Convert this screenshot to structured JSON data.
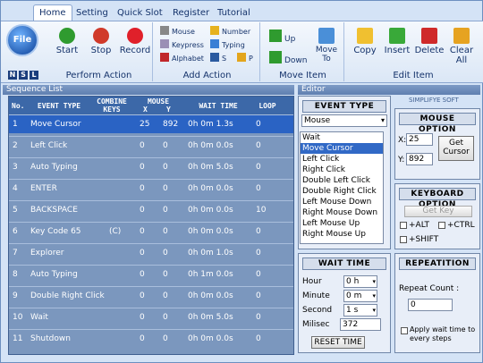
{
  "tabs": [
    "Home",
    "Setting",
    "Quick Slot",
    "Register",
    "Tutorial"
  ],
  "file_button": "File",
  "nsl": [
    "N",
    "S",
    "L"
  ],
  "groups": {
    "perform": {
      "label": "Perform Action",
      "buttons": [
        "Start",
        "Stop",
        "Record"
      ]
    },
    "add": {
      "label": "Add Action",
      "items": [
        "Mouse",
        "Keypress",
        "Alphabet",
        "Number",
        "Typing",
        "S",
        "P"
      ]
    },
    "move": {
      "label": "Move Item",
      "items": [
        "Up",
        "Down"
      ],
      "move_to": "Move To"
    },
    "edit": {
      "label": "Edit Item",
      "buttons": [
        "Copy",
        "Insert",
        "Delete",
        "Clear All"
      ]
    }
  },
  "panes": {
    "sequence_list": "Sequence List",
    "editor": "Editor"
  },
  "table": {
    "headers": {
      "no": "No.",
      "event": "EVENT TYPE",
      "combine": "COMBINE KEYS",
      "mouse": "MOUSE",
      "mx": "X",
      "my": "Y",
      "wait": "WAIT TIME",
      "loop": "LOOP"
    },
    "rows": [
      {
        "no": "1",
        "event": "Move Cursor",
        "keys": "",
        "x": "25",
        "y": "892",
        "wait": "0h 0m 1.3s",
        "loop": "0"
      },
      {
        "no": "2",
        "event": "Left Click",
        "keys": "",
        "x": "0",
        "y": "0",
        "wait": "0h 0m 0.0s",
        "loop": "0"
      },
      {
        "no": "3",
        "event": "Auto Typing",
        "keys": "",
        "x": "0",
        "y": "0",
        "wait": "0h 0m 5.0s",
        "loop": "0"
      },
      {
        "no": "4",
        "event": "ENTER",
        "keys": "",
        "x": "0",
        "y": "0",
        "wait": "0h 0m 0.0s",
        "loop": "0"
      },
      {
        "no": "5",
        "event": "BACKSPACE",
        "keys": "",
        "x": "0",
        "y": "0",
        "wait": "0h 0m 0.0s",
        "loop": "10"
      },
      {
        "no": "6",
        "event": "Key Code 65",
        "keys": "(C)",
        "x": "0",
        "y": "0",
        "wait": "0h 0m 0.0s",
        "loop": "0"
      },
      {
        "no": "7",
        "event": "Explorer",
        "keys": "",
        "x": "0",
        "y": "0",
        "wait": "0h 0m 1.0s",
        "loop": "0"
      },
      {
        "no": "8",
        "event": "Auto Typing",
        "keys": "",
        "x": "0",
        "y": "0",
        "wait": "0h 1m 0.0s",
        "loop": "0"
      },
      {
        "no": "9",
        "event": "Double Right Click",
        "keys": "",
        "x": "0",
        "y": "0",
        "wait": "0h 0m 0.0s",
        "loop": "0"
      },
      {
        "no": "10",
        "event": "Wait",
        "keys": "",
        "x": "0",
        "y": "0",
        "wait": "0h 0m 5.0s",
        "loop": "0"
      },
      {
        "no": "11",
        "event": "Shutdown",
        "keys": "",
        "x": "0",
        "y": "0",
        "wait": "0h 0m 0.0s",
        "loop": "0"
      }
    ]
  },
  "event_type": {
    "title": "EVENT TYPE",
    "selected": "Mouse",
    "list": [
      "Wait",
      "Move Cursor",
      "Left Click",
      "Right Click",
      "Double Left Click",
      "Double Right Click",
      "Left Mouse Down",
      "Right Mouse Down",
      "Left Mouse Up",
      "Right Mouse Up"
    ],
    "highlighted": "Move Cursor"
  },
  "brand": "SIMPLIFYE SOFT",
  "mouse_option": {
    "title": "MOUSE OPTION",
    "x_label": "X:",
    "x": "25",
    "y_label": "Y:",
    "y": "892",
    "get_cursor": "Get Cursor"
  },
  "keyboard_option": {
    "title": "KEYBOARD OPTION",
    "get_key": "Get Key",
    "alt": "+ALT",
    "ctrl": "+CTRL",
    "shift": "+SHIFT"
  },
  "wait_time": {
    "title": "WAIT TIME",
    "hour_label": "Hour",
    "hour": "0 h",
    "minute_label": "Minute",
    "minute": "0 m",
    "second_label": "Second",
    "second": "1 s",
    "milisec_label": "Milisec",
    "milisec": "372",
    "reset": "RESET TIME"
  },
  "repetition": {
    "title": "REPEATITION",
    "count_label": "Repeat Count :",
    "count": "0",
    "apply_label": "Apply wait time to every steps"
  }
}
